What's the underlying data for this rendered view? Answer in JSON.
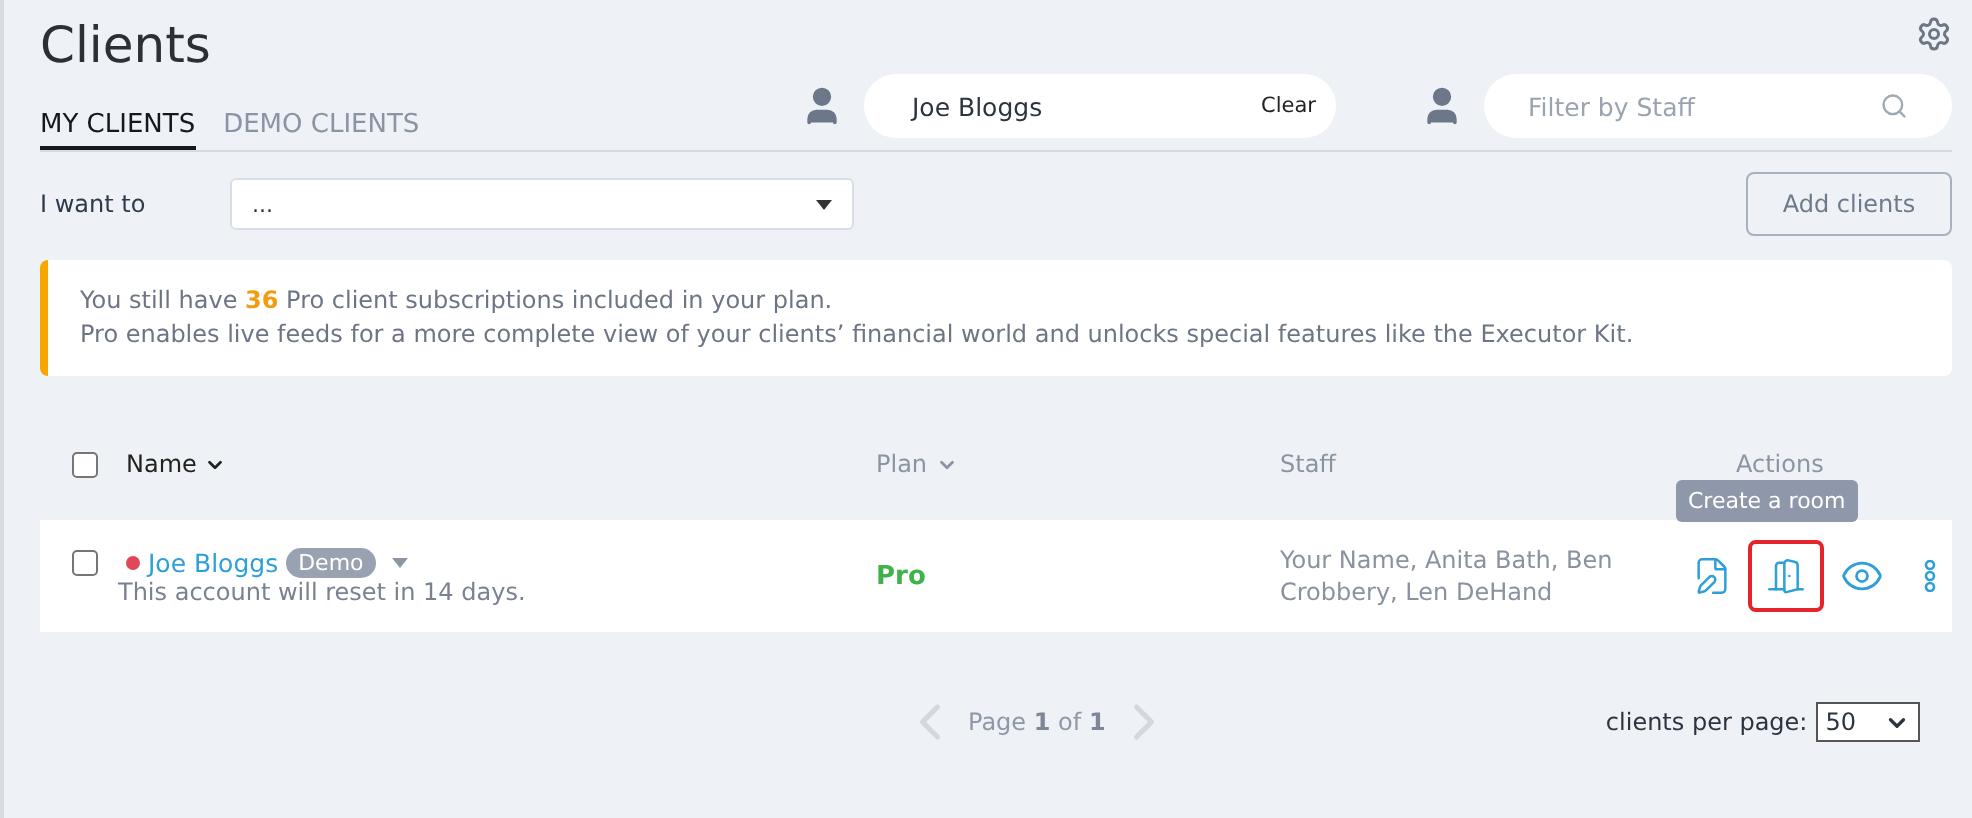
{
  "page_title": "Clients",
  "tabs": [
    {
      "label": "MY CLIENTS",
      "selected": true
    },
    {
      "label": "DEMO CLIENTS",
      "selected": false
    }
  ],
  "client_search": {
    "value": "Joe Bloggs",
    "clear_label": "Clear"
  },
  "staff_filter": {
    "placeholder": "Filter by Staff"
  },
  "action_select": {
    "label": "I want to",
    "value": "..."
  },
  "add_button": "Add clients",
  "notice": {
    "lines": [
      "You still have **36** Pro client subscriptions included in your plan.",
      "Pro enables live feeds for a more complete view of your clients’ financial world and unlocks special features like the Executor Kit."
    ]
  },
  "table": {
    "columns": [
      {
        "label": "Name",
        "sortable": true
      },
      {
        "label": "Plan",
        "sortable": true
      },
      {
        "label": "Staff",
        "sortable": false
      },
      {
        "label": "Actions",
        "sortable": false
      }
    ],
    "header_checked": false,
    "rows": [
      {
        "checked": false,
        "color": "#e0485a",
        "name": "Joe Bloggs",
        "badge": "Demo",
        "note": "This account will reset in 14 days.",
        "plan": "Pro",
        "staff": "Your Name, Anita Bath, Ben Crobbery, Len DeHand",
        "tooltip": "Create a room"
      }
    ]
  },
  "pagination": {
    "text": "Page **1** of **1**",
    "per_page_label": "clients per page:",
    "per_page": "50"
  }
}
